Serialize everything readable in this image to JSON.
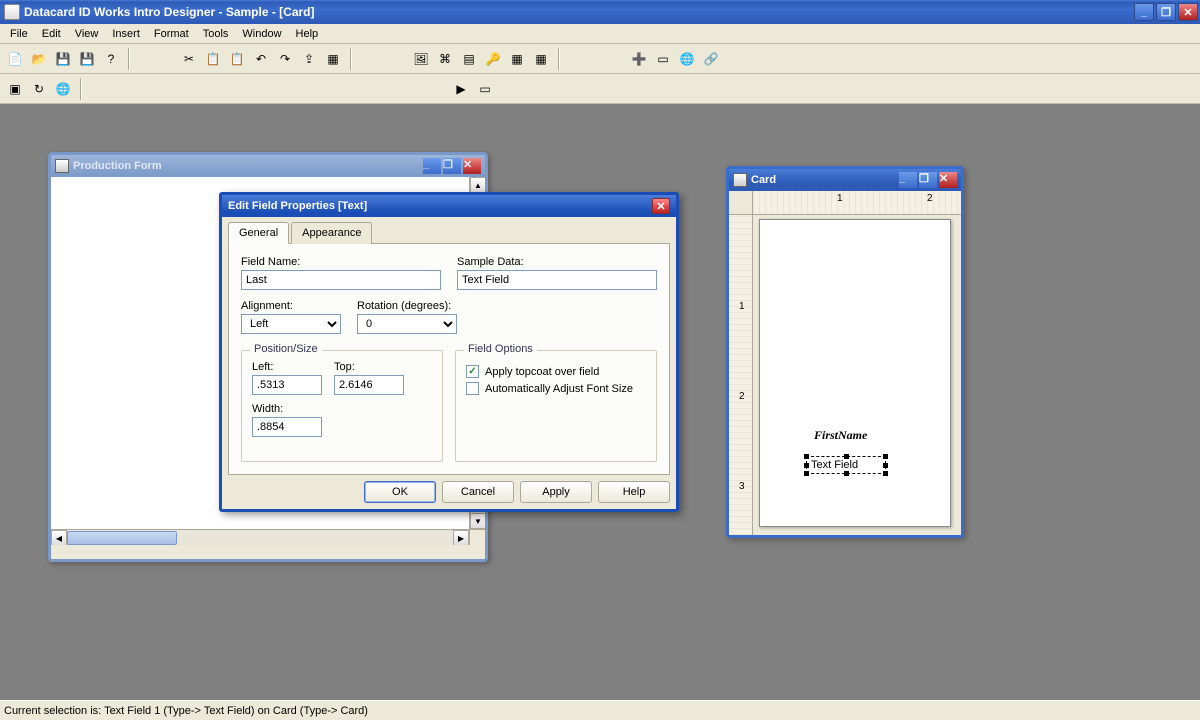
{
  "app": {
    "title": "Datacard ID Works Intro Designer - Sample - [Card]",
    "menus": [
      "File",
      "Edit",
      "View",
      "Insert",
      "Format",
      "Tools",
      "Window",
      "Help"
    ]
  },
  "status": "Current selection is: Text Field 1 (Type-> Text Field) on Card (Type-> Card)",
  "production_window": {
    "title": "Production Form"
  },
  "card_window": {
    "title": "Card",
    "ruler_marks_h": [
      "1",
      "2"
    ],
    "ruler_marks_v": [
      "1",
      "2",
      "3"
    ],
    "field1_text": "FirstName",
    "field2_text": "Text Field"
  },
  "dialog": {
    "title": "Edit Field Properties [Text]",
    "tabs": {
      "general": "General",
      "appearance": "Appearance"
    },
    "labels": {
      "field_name": "Field Name:",
      "sample_data": "Sample Data:",
      "alignment": "Alignment:",
      "rotation": "Rotation (degrees):",
      "position_size": "Position/Size",
      "left": "Left:",
      "top": "Top:",
      "width": "Width:",
      "field_options": "Field Options",
      "apply_topcoat": "Apply topcoat over field",
      "auto_font": "Automatically Adjust Font Size"
    },
    "values": {
      "field_name": "Last",
      "sample_data": "Text Field",
      "alignment": "Left",
      "rotation": "0",
      "left": ".5313",
      "top": "2.6146",
      "width": ".8854"
    },
    "options": {
      "apply_topcoat": true,
      "auto_font": false
    },
    "buttons": {
      "ok": "OK",
      "cancel": "Cancel",
      "apply": "Apply",
      "help": "Help"
    }
  },
  "icons": {
    "toolbar1": [
      "new-icon",
      "open-icon",
      "save-icon",
      "saveas-icon",
      "help-icon"
    ],
    "toolbar1b": [
      "cut-icon",
      "copy-icon",
      "paste-icon",
      "undo-icon",
      "redo-icon",
      "import-icon",
      "snap-icon"
    ],
    "toolbar1c": [
      "image-icon",
      "code-icon",
      "db-icon",
      "key-icon",
      "grid-icon",
      "table-icon"
    ],
    "toolbar1d": [
      "addcard-icon",
      "card-icon",
      "world-icon",
      "chain-icon"
    ],
    "toolbar2a": [
      "app-icon",
      "refresh-icon",
      "globe-icon"
    ],
    "toolbar2b": [
      "run-icon",
      "page-icon"
    ]
  }
}
